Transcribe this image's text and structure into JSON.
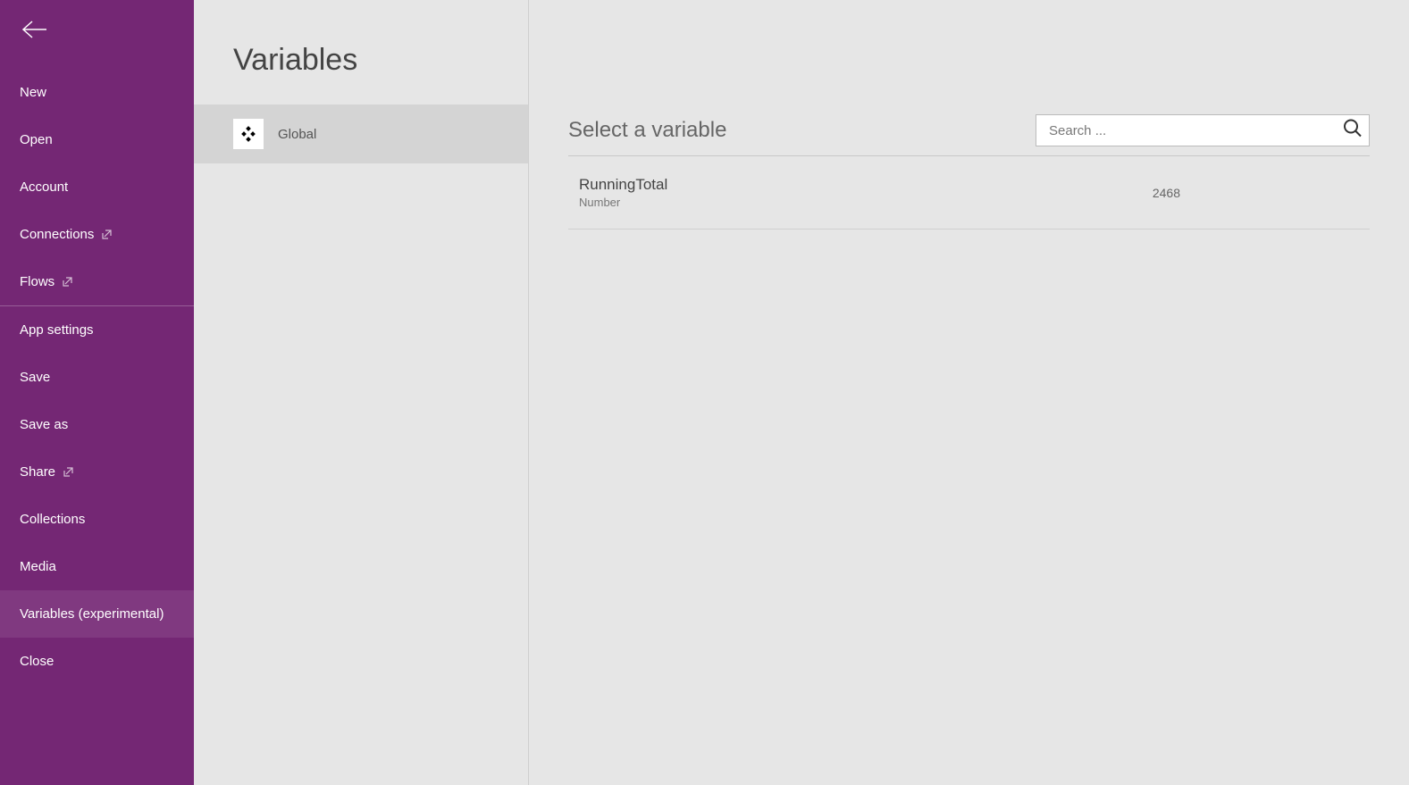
{
  "sidebar": {
    "items": [
      {
        "label": "New",
        "external": false
      },
      {
        "label": "Open",
        "external": false
      },
      {
        "label": "Account",
        "external": false
      },
      {
        "label": "Connections",
        "external": true
      },
      {
        "label": "Flows",
        "external": true
      },
      {
        "label": "App settings",
        "external": false
      },
      {
        "label": "Save",
        "external": false
      },
      {
        "label": "Save as",
        "external": false
      },
      {
        "label": "Share",
        "external": true
      },
      {
        "label": "Collections",
        "external": false
      },
      {
        "label": "Media",
        "external": false
      },
      {
        "label": "Variables (experimental)",
        "external": false
      },
      {
        "label": "Close",
        "external": false
      }
    ]
  },
  "scope_col": {
    "title": "Variables",
    "items": [
      {
        "label": "Global"
      }
    ]
  },
  "main": {
    "title": "Select a variable",
    "search_placeholder": "Search ...",
    "variables": [
      {
        "name": "RunningTotal",
        "type": "Number",
        "value": "2468"
      }
    ]
  }
}
